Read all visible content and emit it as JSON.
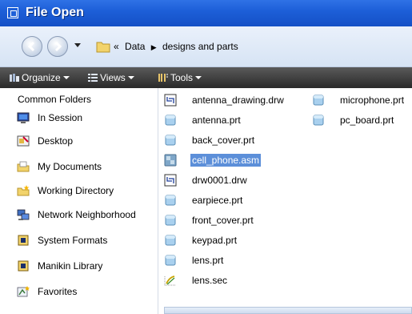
{
  "window": {
    "title": "File Open"
  },
  "address": {
    "overflow": "«",
    "crumbs": [
      "Data",
      "designs and parts"
    ]
  },
  "toolbar": {
    "organize": "Organize",
    "views": "Views",
    "tools": "Tools"
  },
  "sidebar": {
    "heading": "Common Folders",
    "items": [
      {
        "label": "In Session",
        "icon": "monitor-icon"
      },
      {
        "label": "Desktop",
        "icon": "desktop-icon"
      },
      {
        "label": "My Documents",
        "icon": "my-documents-icon"
      },
      {
        "label": "Working Directory",
        "icon": "working-directory-icon"
      },
      {
        "label": "Network Neighborhood",
        "icon": "network-icon"
      },
      {
        "label": "System Formats",
        "icon": "system-formats-icon"
      },
      {
        "label": "Manikin Library",
        "icon": "library-icon"
      },
      {
        "label": "Favorites",
        "icon": "favorites-icon"
      }
    ]
  },
  "files": {
    "column1": [
      {
        "name": "antenna_drawing.drw",
        "type": "drawing"
      },
      {
        "name": "antenna.prt",
        "type": "part"
      },
      {
        "name": "back_cover.prt",
        "type": "part"
      },
      {
        "name": "cell_phone.asm",
        "type": "assembly",
        "selected": true
      },
      {
        "name": "drw0001.drw",
        "type": "drawing"
      },
      {
        "name": "earpiece.prt",
        "type": "part"
      },
      {
        "name": "front_cover.prt",
        "type": "part"
      },
      {
        "name": "keypad.prt",
        "type": "part"
      },
      {
        "name": "lens.prt",
        "type": "part"
      },
      {
        "name": "lens.sec",
        "type": "sketch"
      }
    ],
    "column2": [
      {
        "name": "microphone.prt",
        "type": "part"
      },
      {
        "name": "pc_board.prt",
        "type": "part"
      }
    ]
  },
  "colors": {
    "titlebar": "#1d5fd8",
    "selection": "#5c8fd9",
    "toolbar": "#3a3a3a"
  }
}
